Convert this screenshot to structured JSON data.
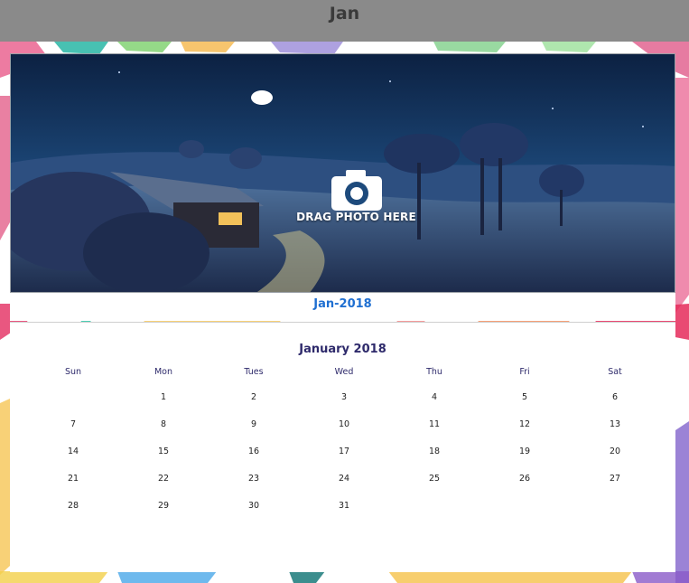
{
  "window": {
    "title": "Jan"
  },
  "photo": {
    "drag_label": "DRAG PHOTO HERE"
  },
  "month_label": "Jan-2018",
  "calendar": {
    "title": "January 2018",
    "weekdays": [
      "Sun",
      "Mon",
      "Tues",
      "Wed",
      "Thu",
      "Fri",
      "Sat"
    ],
    "weeks": [
      [
        "",
        "1",
        "2",
        "3",
        "4",
        "5",
        "6"
      ],
      [
        "7",
        "8",
        "9",
        "10",
        "11",
        "12",
        "13"
      ],
      [
        "14",
        "15",
        "16",
        "17",
        "18",
        "19",
        "20"
      ],
      [
        "21",
        "22",
        "23",
        "24",
        "25",
        "26",
        "27"
      ],
      [
        "28",
        "29",
        "30",
        "31",
        "",
        "",
        ""
      ]
    ]
  },
  "colors": {
    "topbar": "#8a8a8a",
    "month_label": "#1f6fd1",
    "calendar_text": "#2e2a6b"
  },
  "icons": {
    "camera": "camera-icon"
  }
}
